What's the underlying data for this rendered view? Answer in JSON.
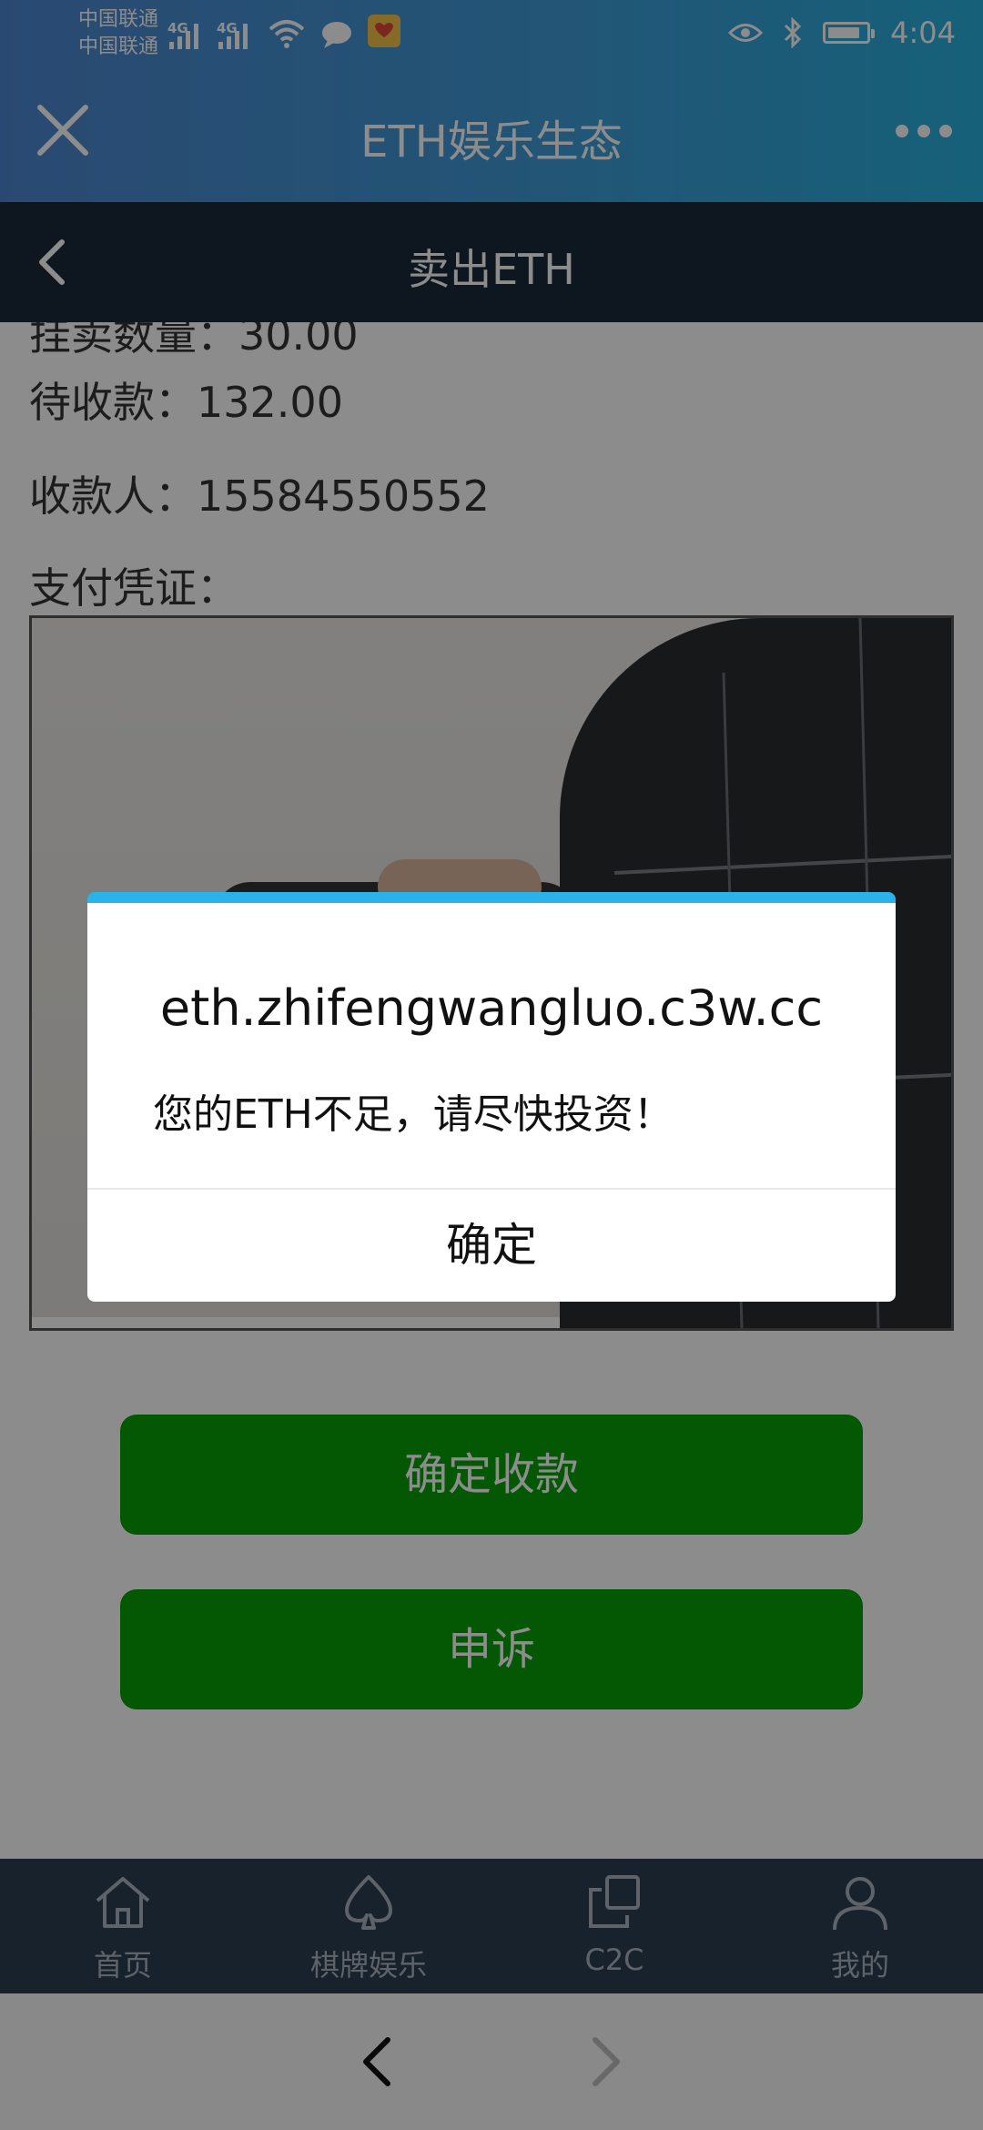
{
  "status_bar": {
    "carrier1": "中国联通",
    "carrier2": "中国联通",
    "network1": "4G",
    "network2": "4G",
    "time": "4:04",
    "battery_level": 0.85
  },
  "app_header": {
    "title": "ETH娱乐生态",
    "close_icon": "close-icon",
    "more_icon": "more-icon"
  },
  "sub_header": {
    "title": "卖出ETH",
    "back_icon": "chevron-left-icon"
  },
  "content": {
    "quantity_line": "挂卖数量：30.00",
    "pending_line": "待收款：132.00",
    "payee_line": "收款人：15584550552",
    "voucher_label": "支付凭证："
  },
  "buttons": {
    "confirm_receipt": "确定收款",
    "appeal": "申诉"
  },
  "tabs": [
    {
      "label": "首页",
      "icon": "home-icon"
    },
    {
      "label": "棋牌娱乐",
      "icon": "spade-icon"
    },
    {
      "label": "C2C",
      "icon": "c2c-icon"
    },
    {
      "label": "我的",
      "icon": "user-icon"
    }
  ],
  "dialog": {
    "title": "eth.zhifengwangluo.c3w.cc",
    "message": "您的ETH不足，请尽快投资！",
    "ok_label": "确定"
  },
  "colors": {
    "header_gradient_start": "#4d86cf",
    "header_gradient_end": "#2ab0de",
    "sub_header": "#1a2a3a",
    "button_green": "#09a009",
    "tab_bar": "#2c3e50",
    "dialog_accent": "#2ab2ea"
  }
}
